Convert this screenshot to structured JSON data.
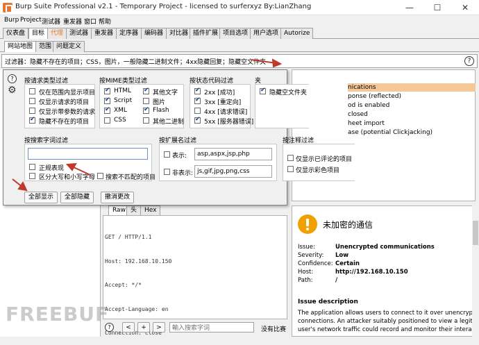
{
  "window": {
    "title": "Burp Suite Professional v2.1 - Temporary Project - licensed to surferxyz By:LianZhang",
    "minimize": "—",
    "maximize": "☐",
    "close": "✕"
  },
  "menubar": [
    "Burp",
    "Project",
    "测试器",
    "重发器",
    "窗口",
    "帮助"
  ],
  "main_tabs": [
    "仪表盘",
    "目标",
    "代理",
    "测试器",
    "重发器",
    "定序器",
    "编码器",
    "对比器",
    "插件扩展",
    "项目选项",
    "用户选项",
    "Autorize"
  ],
  "sub_tabs": [
    "网站地图",
    "范围",
    "问题定义"
  ],
  "filter_bar": {
    "text": "过滤器：隐藏不存在的项目；CSS，图片，一般隐藏二进制文件；4xx隐藏回复；隐藏空文件夹",
    "help": "?"
  },
  "popup": {
    "help": "?",
    "request_type": {
      "title": "按请求类型过滤",
      "items": [
        {
          "label": "仅在范围内显示项目",
          "checked": false
        },
        {
          "label": "仅显示请求的项目",
          "checked": false
        },
        {
          "label": "仅显示带参数的请求",
          "checked": false
        },
        {
          "label": "隐藏不存在的项目",
          "checked": true
        }
      ]
    },
    "mime_type": {
      "title": "按MIME类型过滤",
      "items": [
        {
          "label": "HTML",
          "checked": true
        },
        {
          "label": "其他文字",
          "checked": true
        },
        {
          "label": "Script",
          "checked": true
        },
        {
          "label": "图片",
          "checked": false
        },
        {
          "label": "XML",
          "checked": true
        },
        {
          "label": "Flash",
          "checked": true
        },
        {
          "label": "CSS",
          "checked": false
        },
        {
          "label": "其他二进制",
          "checked": false
        }
      ]
    },
    "status_code": {
      "title": "按状态代码过滤",
      "items": [
        {
          "label": "2xx  [成功]",
          "checked": true
        },
        {
          "label": "3xx  [重定向]",
          "checked": true
        },
        {
          "label": "4xx  [请求错误]",
          "checked": false
        },
        {
          "label": "5xx  [服务器错误]",
          "checked": true
        }
      ]
    },
    "folder": {
      "title": "夹",
      "items": [
        {
          "label": "隐藏空文件夹",
          "checked": true
        }
      ]
    },
    "search": {
      "title": "按搜索字词过滤",
      "value": "",
      "regex": "正规表现",
      "case": "区分大写和小写字母",
      "negative": "搜索不匹配的项目"
    },
    "extension": {
      "title": "按扩展名过滤",
      "show_label": "表示:",
      "show_value": "asp,aspx,jsp,php",
      "hide_label": "非表示:",
      "hide_value": "js,gif,jpg,png,css"
    },
    "annotation": {
      "title": "按注释过滤",
      "commented": "仅显示已评论的项目",
      "highlighted": "仅显示彩色项目"
    },
    "buttons": {
      "show_all": "全部显示",
      "hide_all": "全部隐藏",
      "revert": "撤消更改"
    }
  },
  "issues_list": [
    "nications",
    "ponse (reflected)",
    "od is enabled",
    " closed",
    "heet import",
    "ase (potential Clickjacking)"
  ],
  "request": {
    "tabs": [
      "Raw",
      "头",
      "Hex"
    ],
    "lines": [
      "GET / HTTP/1.1",
      "Host: 192.168.10.150",
      "Accept: */*",
      "Accept-Language: en",
      "Connection: close"
    ],
    "footer": {
      "help": "?",
      "prev": "<",
      "add": "+",
      "next": ">",
      "search_placeholder": "輸入搜索字词",
      "matches": "没有比赛"
    }
  },
  "advisory": {
    "title": "未加密的通信",
    "rows": [
      {
        "k": "Issue:",
        "v": "Unencrypted communications"
      },
      {
        "k": "Severity:",
        "v": "Low"
      },
      {
        "k": "Confidence:",
        "v": "Certain"
      },
      {
        "k": "Host:",
        "v": "http://192.168.10.150"
      },
      {
        "k": "Path:",
        "v": "/"
      }
    ],
    "desc_title": "Issue description",
    "desc_lines": [
      "The application allows users to connect to it over unencrypted",
      "connections. An attacker suitably positioned to view a legitimate",
      "user's network traffic could record and monitor their interactions"
    ]
  },
  "watermark": "FREEBUF",
  "colors": {
    "accent": "#e8772e",
    "arrow": "#c0392b",
    "warning": "#f0a000",
    "highlight": "#f5c89a"
  }
}
